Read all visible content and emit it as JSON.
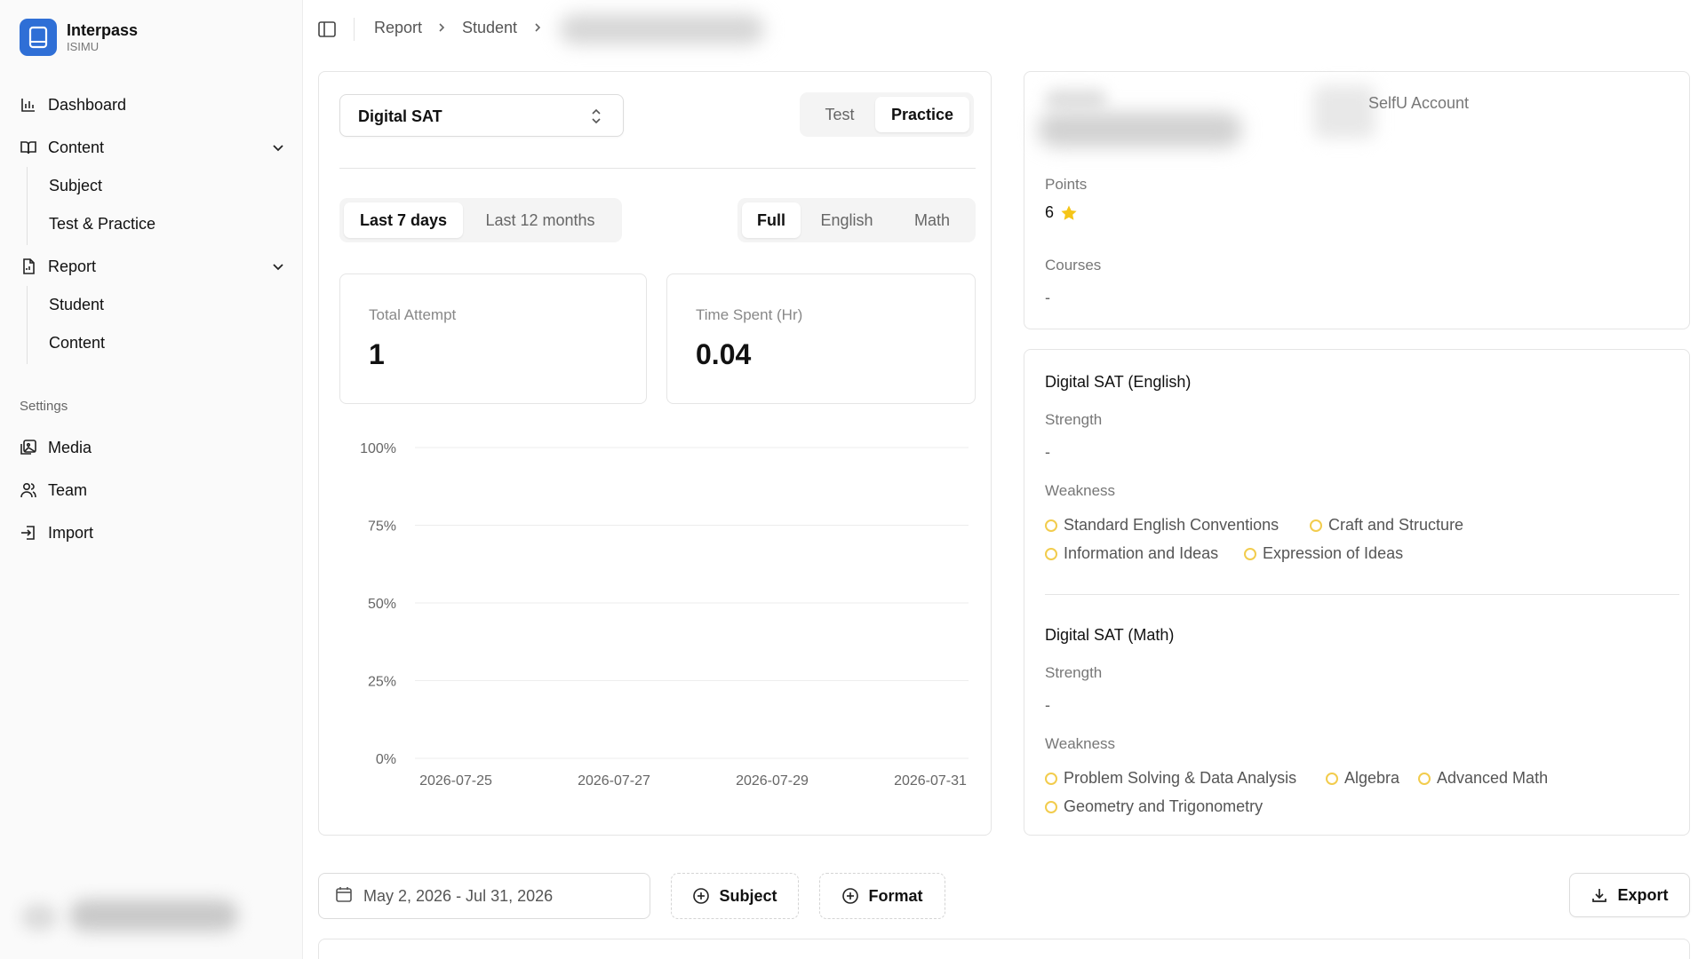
{
  "brand": {
    "name": "Interpass",
    "org": "ISIMU",
    "color": "#2f6fd6"
  },
  "sidebar": {
    "dashboard": "Dashboard",
    "content": {
      "label": "Content",
      "items": [
        "Subject",
        "Test & Practice"
      ]
    },
    "report": {
      "label": "Report",
      "items": [
        "Student",
        "Content"
      ]
    },
    "settings_label": "Settings",
    "media": "Media",
    "team": "Team",
    "import": "Import"
  },
  "breadcrumb": [
    "Report",
    "Student"
  ],
  "filters": {
    "exam_select": "Digital SAT",
    "mode_tabs": [
      "Test",
      "Practice"
    ],
    "mode_active": "Practice",
    "range_tabs": [
      "Last 7 days",
      "Last 12 months"
    ],
    "range_active": "Last 7 days",
    "section_tabs": [
      "Full",
      "English",
      "Math"
    ],
    "section_active": "Full"
  },
  "stats": {
    "total_attempt_label": "Total Attempt",
    "total_attempt_value": "1",
    "time_spent_label": "Time Spent (Hr)",
    "time_spent_value": "0.04"
  },
  "chart_data": {
    "type": "line",
    "x_ticks": [
      "2026-07-25",
      "2026-07-27",
      "2026-07-29",
      "2026-07-31"
    ],
    "y_ticks": [
      "100%",
      "75%",
      "50%",
      "25%",
      "0%"
    ],
    "ylim": [
      0,
      100
    ],
    "series": [],
    "grid": true
  },
  "profile": {
    "account_text": "SelfU Account",
    "points_label": "Points",
    "points_value": "6",
    "courses_label": "Courses",
    "courses_value": "-"
  },
  "english": {
    "title": "Digital SAT (English)",
    "strength_label": "Strength",
    "strength_value": "-",
    "weakness_label": "Weakness",
    "weaknesses": [
      "Standard English Conventions",
      "Craft and Structure",
      "Information and Ideas",
      "Expression of Ideas"
    ]
  },
  "math": {
    "title": "Digital SAT (Math)",
    "strength_label": "Strength",
    "strength_value": "-",
    "weakness_label": "Weakness",
    "weaknesses": [
      "Problem Solving & Data Analysis",
      "Algebra",
      "Advanced Math",
      "Geometry and Trigonometry"
    ]
  },
  "toolbar": {
    "date_range": "May 2, 2026 - Jul 31, 2026",
    "subject_button": "Subject",
    "format_button": "Format",
    "export_button": "Export"
  },
  "icons": {
    "star_color": "#f5c518",
    "weakness_dot_color": "#f2cc4d"
  }
}
